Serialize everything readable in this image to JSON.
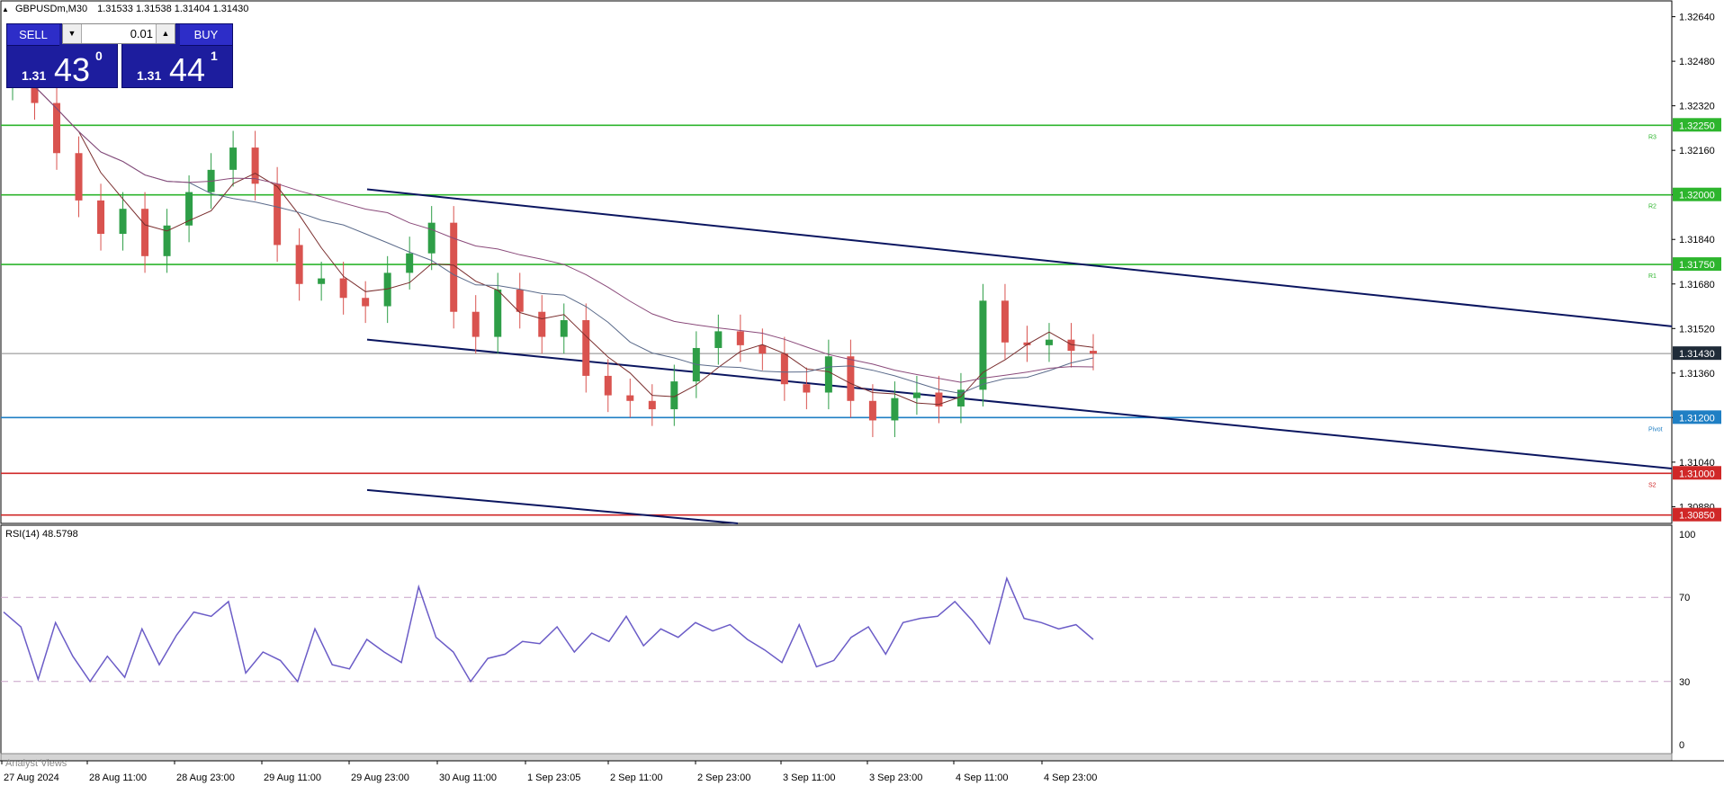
{
  "header": {
    "symbol": "GBPUSDm,M30",
    "values": "1.31533 1.31538 1.31404 1.31430"
  },
  "trade_panel": {
    "sell_label": "SELL",
    "buy_label": "BUY",
    "lot": "0.01",
    "sell_prefix": "1.31",
    "sell_big": "43",
    "sell_sup": "0",
    "buy_prefix": "1.31",
    "buy_big": "44",
    "buy_sup": "1"
  },
  "chart_data": {
    "type": "candlestick",
    "symbol": "GBPUSDm",
    "timeframe": "M30",
    "price_axis_labels": [
      "1.32640",
      "1.32480",
      "1.32320",
      "1.32160",
      "1.32000",
      "1.31840",
      "1.31680",
      "1.31520",
      "1.31360",
      "1.31200",
      "1.31040",
      "1.30880"
    ],
    "ylim": [
      1.3082,
      1.327
    ],
    "x_labels": [
      "27 Aug 2024",
      "28 Aug 11:00",
      "28 Aug 23:00",
      "29 Aug 11:00",
      "29 Aug 23:00",
      "30 Aug 11:00",
      "1 Sep 23:05",
      "2 Sep 11:00",
      "2 Sep 23:00",
      "3 Sep 11:00",
      "3 Sep 23:00",
      "4 Sep 11:00",
      "4 Sep 23:00"
    ],
    "current_price": "1.31430",
    "levels": [
      {
        "name": "R3",
        "price": 1.3225,
        "label": "1.32250",
        "color": "#2db52d"
      },
      {
        "name": "R2",
        "price": 1.32,
        "label": "1.32000",
        "color": "#2db52d"
      },
      {
        "name": "R1",
        "price": 1.3175,
        "label": "1.31750",
        "color": "#2db52d"
      },
      {
        "name": "Pivot",
        "price": 1.312,
        "label": "1.31200",
        "color": "#1f7fc4"
      },
      {
        "name": "S2",
        "price": 1.31,
        "label": "1.31000",
        "color": "#d02828"
      },
      {
        "name": "",
        "price": 1.3085,
        "label": "1.30850",
        "color": "#d02828"
      }
    ],
    "colors": {
      "bull": "#2e9e47",
      "bear": "#d9534f",
      "channel": "#0b1660",
      "ma_fast": "#7a2e2e",
      "ma_mid": "#5a6a8a",
      "ma_slow": "#8a4a7a",
      "rsi": "#6b5cc7"
    },
    "close": [
      1.3245,
      1.3233,
      1.3215,
      1.3198,
      1.3186,
      1.3195,
      1.3178,
      1.3189,
      1.3201,
      1.3209,
      1.3217,
      1.3204,
      1.3182,
      1.3168,
      1.317,
      1.3163,
      1.316,
      1.3172,
      1.3179,
      1.319,
      1.3158,
      1.3149,
      1.3166,
      1.3158,
      1.3149,
      1.3155,
      1.3135,
      1.3128,
      1.3126,
      1.3123,
      1.3133,
      1.3145,
      1.3151,
      1.3146,
      1.3143,
      1.3132,
      1.3129,
      1.3142,
      1.3126,
      1.3119,
      1.3127,
      1.3129,
      1.3124,
      1.313,
      1.3162,
      1.3147,
      1.3146,
      1.3148,
      1.3144,
      1.3143
    ],
    "rsi": {
      "label": "RSI(14) 48.5798",
      "levels": [
        70,
        30
      ],
      "axis": [
        "100",
        "70",
        "30",
        "0"
      ],
      "values": [
        63,
        56,
        31,
        58,
        42,
        30,
        42,
        32,
        55,
        38,
        52,
        63,
        61,
        68,
        34,
        44,
        40,
        30,
        55,
        38,
        36,
        50,
        44,
        39,
        75,
        51,
        44,
        30,
        41,
        43,
        49,
        48,
        56,
        44,
        53,
        49,
        61,
        47,
        55,
        51,
        58,
        54,
        57,
        50,
        45,
        39,
        57,
        37,
        40,
        51,
        56,
        43,
        58,
        60,
        61,
        68,
        59,
        48,
        79,
        60,
        58,
        55,
        57,
        50
      ]
    }
  },
  "chart_text": {
    "rsi_label": "RSI(14) 48.5798",
    "analyst": "Analyst Views",
    "current_price": "1.31430",
    "r3": "R3",
    "r2": "R2",
    "r1": "R1",
    "pivot": "Pivot",
    "s2": "S2"
  }
}
